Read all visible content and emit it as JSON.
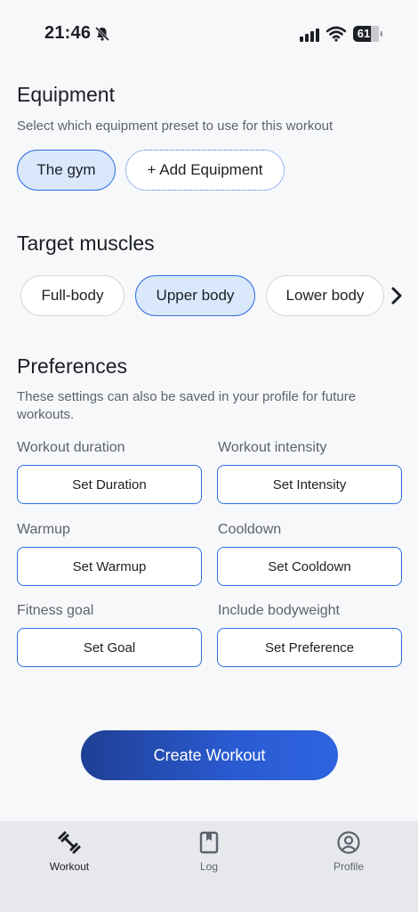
{
  "status": {
    "time": "21:46",
    "battery": "61"
  },
  "equipment": {
    "title": "Equipment",
    "description": "Select which equipment preset to use for this workout",
    "options": [
      "The gym",
      "+ Add Equipment"
    ]
  },
  "muscles": {
    "title": "Target muscles",
    "options": [
      "Full-body",
      "Upper body",
      "Lower body"
    ]
  },
  "preferences": {
    "title": "Preferences",
    "description": "These settings can also be saved in your profile for future workouts.",
    "fields": [
      {
        "label": "Workout duration",
        "button": "Set Duration"
      },
      {
        "label": "Workout intensity",
        "button": "Set Intensity"
      },
      {
        "label": "Warmup",
        "button": "Set Warmup"
      },
      {
        "label": "Cooldown",
        "button": "Set Cooldown"
      },
      {
        "label": "Fitness goal",
        "button": "Set Goal"
      },
      {
        "label": "Include bodyweight",
        "button": "Set Preference"
      }
    ]
  },
  "create_label": "Create Workout",
  "tabs": [
    {
      "label": "Workout",
      "icon": "dumbbell-icon"
    },
    {
      "label": "Log",
      "icon": "book-icon"
    },
    {
      "label": "Profile",
      "icon": "profile-icon"
    }
  ],
  "colors": {
    "accent": "#2f6fe0",
    "selected_bg": "#d9e8fb",
    "cta_start": "#1f3f94",
    "cta_end": "#2f63e0"
  }
}
